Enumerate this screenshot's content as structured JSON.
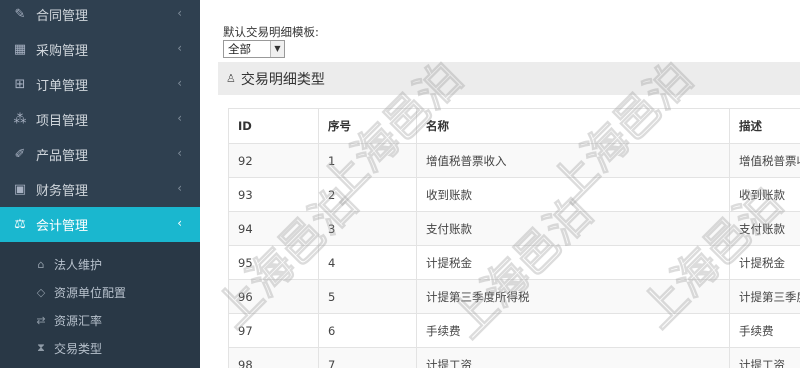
{
  "sidebar": {
    "items": [
      {
        "label": "合同管理",
        "icon": "edit-icon",
        "glyph": "✎",
        "chevron": "‹"
      },
      {
        "label": "采购管理",
        "icon": "box-icon",
        "glyph": "▦",
        "chevron": "‹"
      },
      {
        "label": "订单管理",
        "icon": "cart-icon",
        "glyph": "⊞",
        "chevron": "‹"
      },
      {
        "label": "项目管理",
        "icon": "cubes-icon",
        "glyph": "⁂",
        "chevron": "‹"
      },
      {
        "label": "产品管理",
        "icon": "pencil-icon",
        "glyph": "✐",
        "chevron": "‹"
      },
      {
        "label": "财务管理",
        "icon": "money-icon",
        "glyph": "▣",
        "chevron": "‹"
      },
      {
        "label": "会计管理",
        "icon": "balance-scale-icon",
        "glyph": "⚖",
        "chevron": "‹"
      }
    ],
    "submenu": [
      {
        "label": "法人维护",
        "icon": "bank-icon",
        "glyph": "⌂"
      },
      {
        "label": "资源单位配置",
        "icon": "diamond-icon",
        "glyph": "◇"
      },
      {
        "label": "资源汇率",
        "icon": "exchange-icon",
        "glyph": "⇄"
      },
      {
        "label": "交易类型",
        "icon": "hourglass-icon",
        "glyph": "⧗"
      }
    ]
  },
  "template": {
    "label": "默认交易明细模板:",
    "selected": "全部",
    "arrow": "▼"
  },
  "panel": {
    "title": "交易明细类型",
    "icon_glyph": "♙"
  },
  "table": {
    "headers": {
      "id": "ID",
      "seq": "序号",
      "name": "名称",
      "desc": "描述"
    },
    "rows": [
      {
        "id": "92",
        "seq": "1",
        "name": "增值税普票收入",
        "desc": "增值税普票收入"
      },
      {
        "id": "93",
        "seq": "2",
        "name": "收到账款",
        "desc": "收到账款"
      },
      {
        "id": "94",
        "seq": "3",
        "name": "支付账款",
        "desc": "支付账款"
      },
      {
        "id": "95",
        "seq": "4",
        "name": "计提税金",
        "desc": "计提税金"
      },
      {
        "id": "96",
        "seq": "5",
        "name": "计提第三季度所得税",
        "desc": "计提第三季度所得税"
      },
      {
        "id": "97",
        "seq": "6",
        "name": "手续费",
        "desc": "手续费"
      },
      {
        "id": "98",
        "seq": "7",
        "name": "计提工资",
        "desc": "计提工资"
      }
    ]
  },
  "watermark": {
    "text": "上海邑泊"
  },
  "colors": {
    "sidebar_bg": "#2f4050",
    "active_bg": "#1ab7cf",
    "submenu_bg": "#293846",
    "panel_head_bg": "#ececec"
  }
}
